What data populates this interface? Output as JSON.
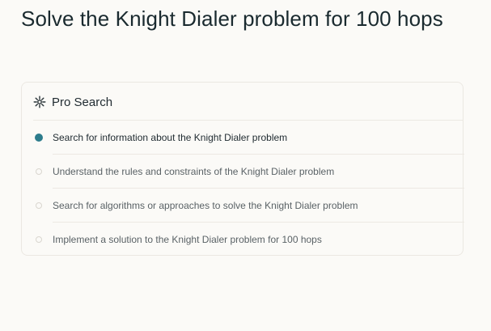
{
  "title": "Solve the Knight Dialer problem for 100 hops",
  "card": {
    "header_icon": "pro-search-icon",
    "header_label": "Pro Search",
    "accent_color": "#2d7c8c",
    "steps": [
      {
        "label": "Search for information about the Knight Dialer problem",
        "status": "active"
      },
      {
        "label": "Understand the rules and constraints of the Knight Dialer problem",
        "status": "pending"
      },
      {
        "label": "Search for algorithms or approaches to solve the Knight Dialer problem",
        "status": "pending"
      },
      {
        "label": "Implement a solution to the Knight Dialer problem for 100 hops",
        "status": "pending"
      }
    ]
  }
}
